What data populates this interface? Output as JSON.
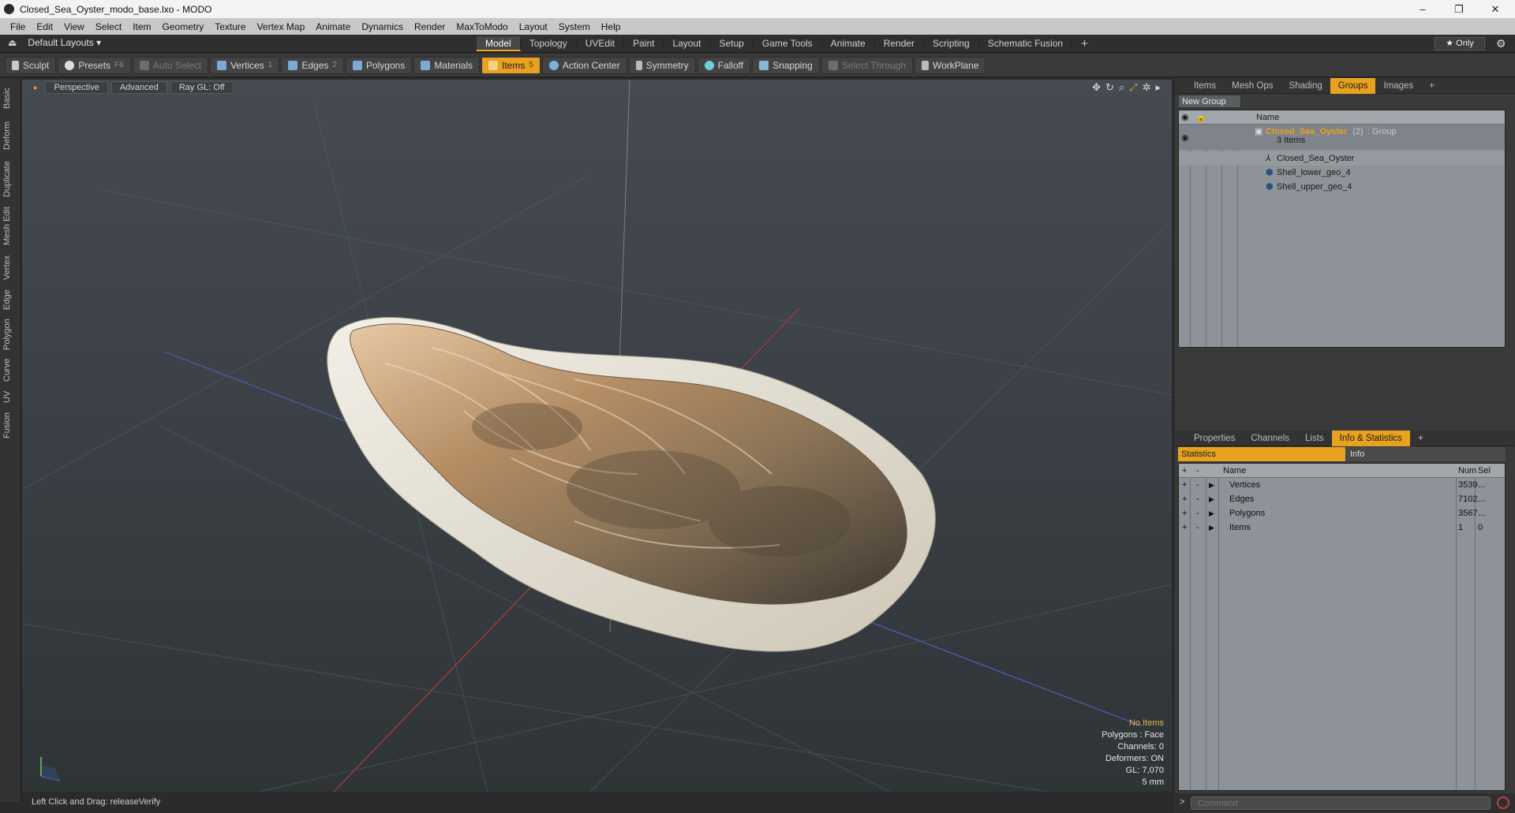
{
  "window": {
    "title": "Closed_Sea_Oyster_modo_base.lxo - MODO",
    "minimize": "–",
    "maximize": "❐",
    "close": "✕"
  },
  "menu": [
    "File",
    "Edit",
    "View",
    "Select",
    "Item",
    "Geometry",
    "Texture",
    "Vertex Map",
    "Animate",
    "Dynamics",
    "Render",
    "MaxToModo",
    "Layout",
    "System",
    "Help"
  ],
  "layout": {
    "label": "Default Layouts ▾",
    "only": "★ Only"
  },
  "mode_tabs": [
    {
      "label": "Model",
      "active": true
    },
    {
      "label": "Topology"
    },
    {
      "label": "UVEdit"
    },
    {
      "label": "Paint"
    },
    {
      "label": "Layout"
    },
    {
      "label": "Setup"
    },
    {
      "label": "Game Tools"
    },
    {
      "label": "Animate"
    },
    {
      "label": "Render"
    },
    {
      "label": "Scripting"
    },
    {
      "label": "Schematic Fusion"
    }
  ],
  "toolbar": [
    {
      "label": "Sculpt",
      "icon": "sculpt-icon"
    },
    {
      "label": "Presets",
      "key": "F6",
      "icon": "presets-icon"
    },
    {
      "label": "Auto Select",
      "dim": true,
      "icon": "auto-select-icon"
    },
    {
      "label": "Vertices",
      "key": "1",
      "icon": "vertices-icon"
    },
    {
      "label": "Edges",
      "key": "2",
      "icon": "edges-icon"
    },
    {
      "label": "Polygons",
      "icon": "polygons-icon"
    },
    {
      "label": "Materials",
      "icon": "materials-icon"
    },
    {
      "label": "Items",
      "key": "5",
      "active": true,
      "icon": "items-icon"
    },
    {
      "label": "Action Center",
      "icon": "action-center-icon"
    },
    {
      "label": "Symmetry",
      "icon": "symmetry-icon"
    },
    {
      "label": "Falloff",
      "icon": "falloff-icon"
    },
    {
      "label": "Snapping",
      "icon": "snapping-icon"
    },
    {
      "label": "Select Through",
      "dim": true,
      "icon": "select-through-icon"
    },
    {
      "label": "WorkPlane",
      "icon": "workplane-icon"
    }
  ],
  "left_tabs": [
    "Basic",
    "Deform",
    "Duplicate",
    "Mesh Edit",
    "Vertex",
    "Edge",
    "Polygon",
    "Curve",
    "UV",
    "Fusion"
  ],
  "viewport": {
    "view": "Perspective",
    "shading": "Advanced",
    "raygl": "Ray GL: Off",
    "info": {
      "selection": "No Items",
      "polygons": "Polygons : Face",
      "channels": "Channels: 0",
      "deformers": "Deformers: ON",
      "gl": "GL: 7,070",
      "unit": "5 mm"
    }
  },
  "statusbar": "Left Click and Drag:   releaseVerify",
  "top_panel": {
    "tabs": [
      {
        "label": "Items"
      },
      {
        "label": "Mesh Ops"
      },
      {
        "label": "Shading"
      },
      {
        "label": "Groups",
        "active": true
      },
      {
        "label": "Images"
      },
      {
        "label": "+"
      }
    ],
    "new_group": "New Group",
    "name_header": "Name",
    "group": {
      "name": "Closed_Sea_Oyster",
      "count": "(2)",
      "type": ": Group",
      "items_count": "3 Items"
    },
    "children": [
      "Closed_Sea_Oyster",
      "Shell_lower_geo_4",
      "Shell_upper_geo_4"
    ]
  },
  "bottom_panel": {
    "tabs": [
      {
        "label": "Properties"
      },
      {
        "label": "Channels"
      },
      {
        "label": "Lists"
      },
      {
        "label": "Info & Statistics",
        "active": true
      },
      {
        "label": "+"
      }
    ],
    "subtabs": {
      "statistics": "Statistics",
      "info": "Info"
    },
    "headers": {
      "name": "Name",
      "num": "Num",
      "sel": "Sel"
    },
    "rows": [
      {
        "name": "Vertices",
        "num": "3539",
        "sel": "..."
      },
      {
        "name": "Edges",
        "num": "7102",
        "sel": "..."
      },
      {
        "name": "Polygons",
        "num": "3567",
        "sel": "..."
      },
      {
        "name": "Items",
        "num": "1",
        "sel": "0"
      }
    ]
  },
  "command": {
    "prompt": ">",
    "placeholder": "Command"
  },
  "colors": {
    "accent": "#e8a21f",
    "panel": "#8d9398",
    "viewport": "#3b4146"
  }
}
